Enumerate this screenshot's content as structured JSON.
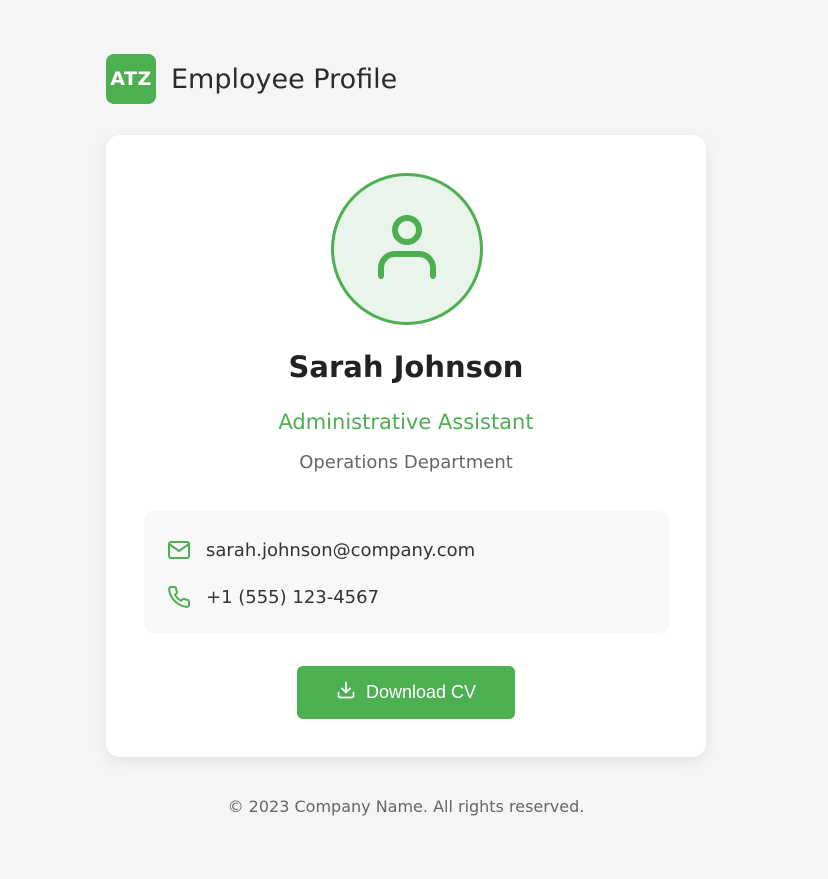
{
  "header": {
    "logo_text": "ATZ",
    "title": "Employee Profile"
  },
  "profile": {
    "avatar_icon": "user-icon",
    "name": "Sarah Johnson",
    "role": "Administrative Assistant",
    "department": "Operations Department"
  },
  "contact": {
    "email": "sarah.johnson@company.com",
    "email_icon": "mail-icon",
    "phone": "+1 (555) 123-4567",
    "phone_icon": "phone-icon"
  },
  "actions": {
    "download_label": "Download CV",
    "download_icon": "download-icon"
  },
  "footer": {
    "text": "© 2023 Company Name. All rights reserved."
  },
  "colors": {
    "accent": "#4caf50",
    "avatar_bg": "#e9f4ea",
    "page_bg": "#f5f5f5"
  }
}
